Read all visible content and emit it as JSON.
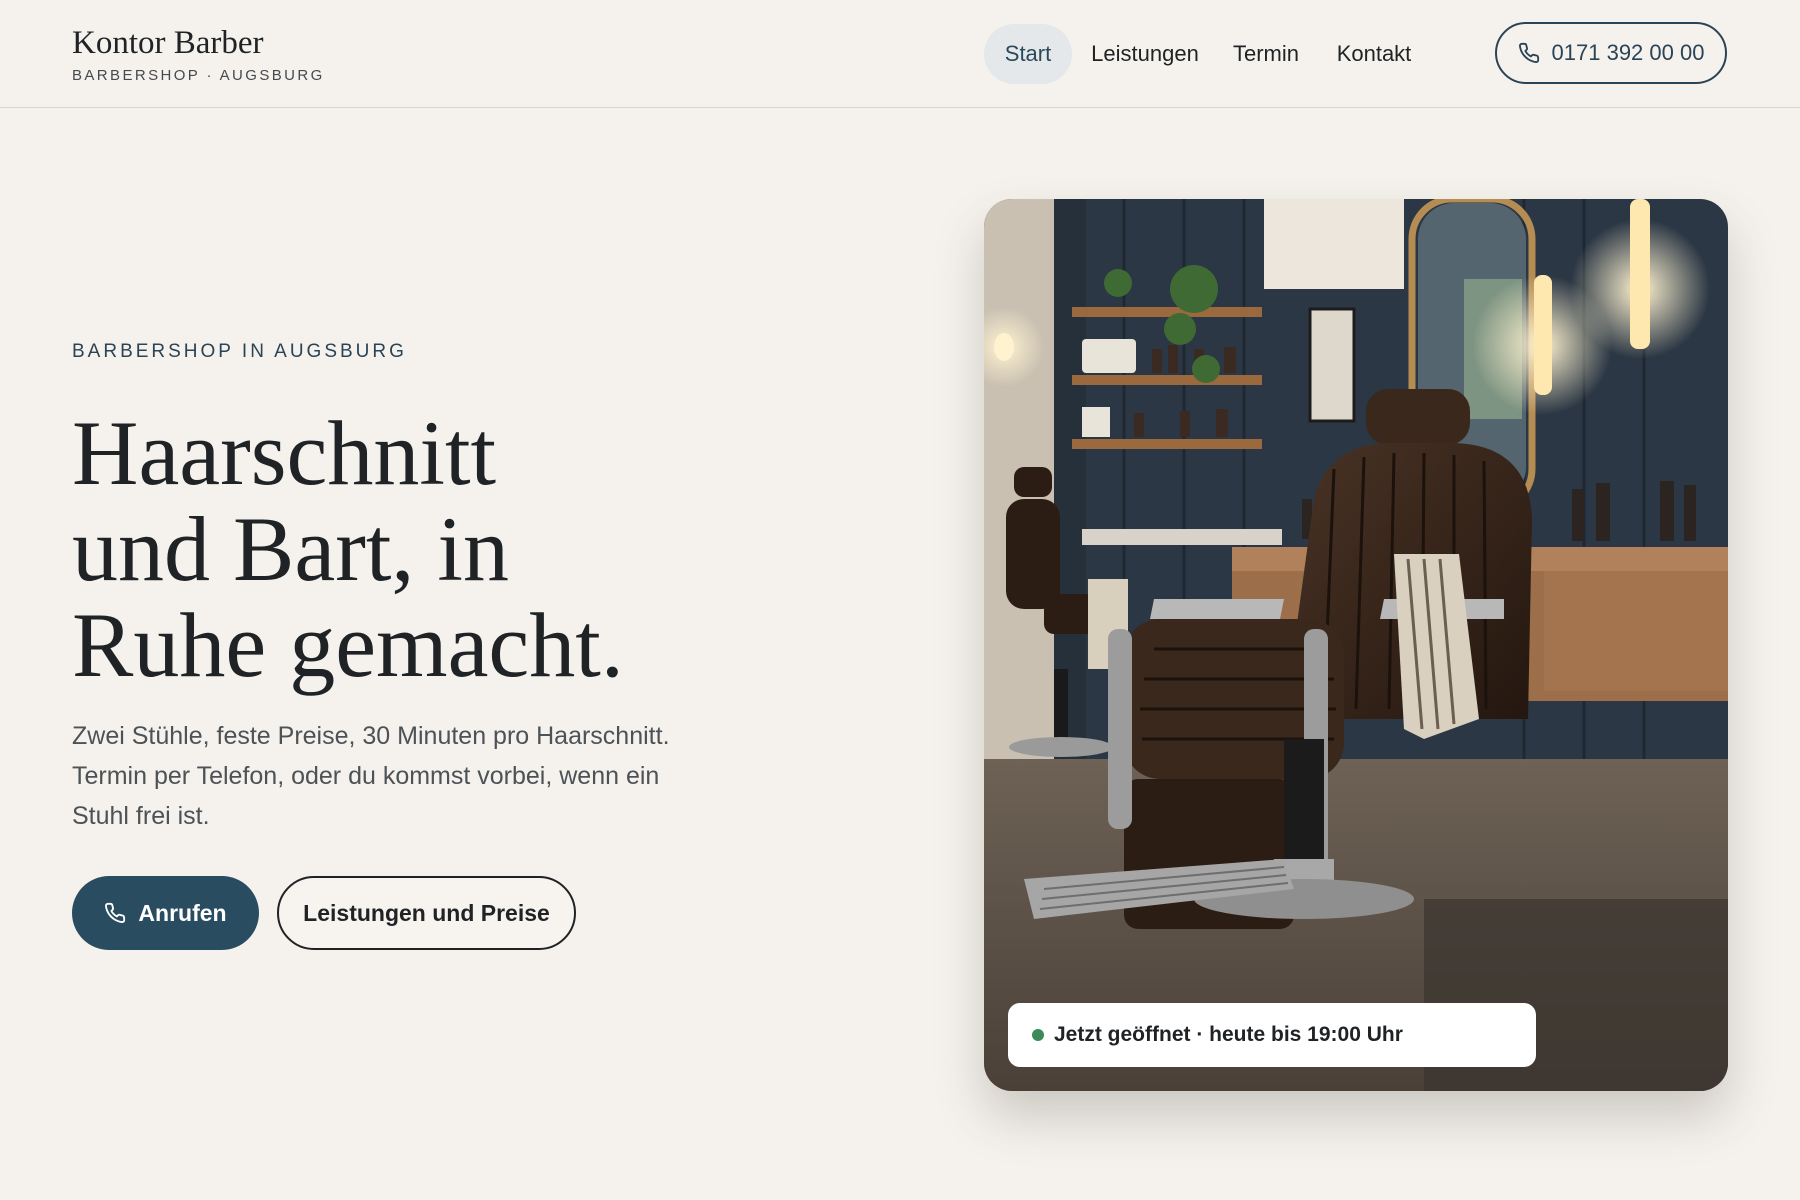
{
  "brand": {
    "name": "Kontor Barber",
    "subtitle": "BARBERSHOP · AUGSBURG"
  },
  "nav": {
    "items": [
      {
        "label": "Start",
        "active": true
      },
      {
        "label": "Leistungen",
        "active": false
      },
      {
        "label": "Termin",
        "active": false
      },
      {
        "label": "Kontakt",
        "active": false
      }
    ],
    "phone_label": "0171 392 00 00",
    "phone_icon": "phone-icon"
  },
  "hero": {
    "eyebrow": "BARBERSHOP IN AUGSBURG",
    "headline_line1": "Haarschnitt",
    "headline_line2": "und Bart, in",
    "headline_line3": "Ruhe gemacht.",
    "lead": "Zwei Stühle, feste Preise, 30 Minuten pro Haarschnitt. Termin per Telefon, oder du kommst vorbei, wenn ein Stuhl frei ist.",
    "primary_button": "Anrufen",
    "secondary_button": "Leistungen und Preise"
  },
  "status": {
    "text": "Jetzt geöffnet · heute bis 19:00 Uhr",
    "dot_color": "#3a8a5a"
  },
  "colors": {
    "background": "#f5f2ed",
    "accent": "#2a4c60",
    "text": "#1f2326"
  }
}
